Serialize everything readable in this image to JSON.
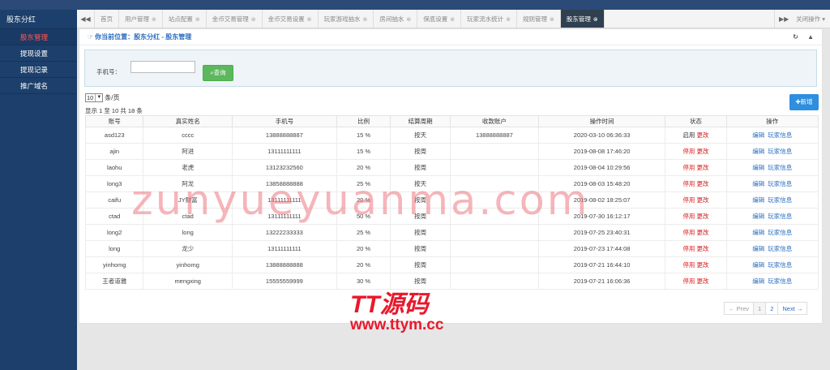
{
  "sidebar": {
    "title": "股东分红",
    "items": [
      {
        "label": "股东管理",
        "active": true
      },
      {
        "label": "提现设置",
        "active": false
      },
      {
        "label": "提现记录",
        "active": false
      },
      {
        "label": "推广域名",
        "active": false
      }
    ]
  },
  "tabbar": {
    "tabs": [
      "首页",
      "用户管理",
      "站点配置",
      "金币交易管理",
      "金币交易设置",
      "玩家游戏抽水",
      "房间抽水",
      "保底设置",
      "玩家流水统计",
      "规则管理",
      "股东管理"
    ],
    "active_index": 10,
    "close_ops_label": "关闭操作"
  },
  "breadcrumb": "你当前位置：股东分红 - 股东管理",
  "search": {
    "label": "手机号：",
    "value": "",
    "placeholder": "",
    "button_label": "查询"
  },
  "pagesize": {
    "value": "10",
    "suffix": "条/页"
  },
  "summary": "显示 1 至 10 共 18 条",
  "add_button": "新增",
  "table": {
    "headers": [
      "账号",
      "真实姓名",
      "手机号",
      "比例",
      "结算周期",
      "收款账户",
      "操作时间",
      "状态",
      "操作"
    ],
    "rows": [
      {
        "account": "asd123",
        "name": "cccc",
        "phone": "13888888887",
        "ratio": "15 %",
        "cycle": "按天",
        "payee": "13888888887",
        "time": "2020-03-10 06:36:33",
        "status": "启用",
        "status_on": true
      },
      {
        "account": "ajin",
        "name": "阿进",
        "phone": "13111111111",
        "ratio": "15 %",
        "cycle": "按周",
        "payee": "",
        "time": "2019-08-08 17:46:20",
        "status": "停用",
        "status_on": false
      },
      {
        "account": "laohu",
        "name": "老虎",
        "phone": "13123232560",
        "ratio": "20 %",
        "cycle": "按周",
        "payee": "",
        "time": "2019-08-04 10:29:56",
        "status": "停用",
        "status_on": false
      },
      {
        "account": "long3",
        "name": "阿龙",
        "phone": "13858888888",
        "ratio": "25 %",
        "cycle": "按天",
        "payee": "",
        "time": "2019-08-03 15:48:20",
        "status": "停用",
        "status_on": false
      },
      {
        "account": "caifu",
        "name": "JY财富",
        "phone": "13111111111",
        "ratio": "20 %",
        "cycle": "按周",
        "payee": "",
        "time": "2019-08-02 18:25:07",
        "status": "停用",
        "status_on": false
      },
      {
        "account": "ctad",
        "name": "ctad",
        "phone": "13111111111",
        "ratio": "50 %",
        "cycle": "按周",
        "payee": "",
        "time": "2019-07-30 16:12:17",
        "status": "停用",
        "status_on": false
      },
      {
        "account": "long2",
        "name": "long",
        "phone": "13222233333",
        "ratio": "25 %",
        "cycle": "按周",
        "payee": "",
        "time": "2019-07-25 23:40:31",
        "status": "停用",
        "status_on": false
      },
      {
        "account": "long",
        "name": "龙少",
        "phone": "13111111111",
        "ratio": "20 %",
        "cycle": "按周",
        "payee": "",
        "time": "2019-07-23 17:44:08",
        "status": "停用",
        "status_on": false
      },
      {
        "account": "yinhomg",
        "name": "yinhomg",
        "phone": "13888888888",
        "ratio": "20 %",
        "cycle": "按周",
        "payee": "",
        "time": "2019-07-21 16:44:10",
        "status": "停用",
        "status_on": false
      },
      {
        "account": "王者道雅",
        "name": "mengxing",
        "phone": "15555559999",
        "ratio": "30 %",
        "cycle": "按周",
        "payee": "",
        "time": "2019-07-21 16:06:36",
        "status": "停用",
        "status_on": false
      }
    ],
    "status_edit_label": "更改",
    "op_edit_label": "编辑",
    "op_player_label": "玩家信息"
  },
  "pager": {
    "prev": "← Prev",
    "pages": [
      "1",
      "2"
    ],
    "current": "1",
    "next": "Next →"
  },
  "watermark": {
    "text": "zunyueyuanma.com",
    "logo": "TT源码",
    "url": "www.ttym.cc"
  },
  "colors": {
    "sidebar": "#1c3f6b",
    "active_tab": "#2f4050",
    "accent_red": "#e02020",
    "link_blue": "#2a6dbf",
    "search_green": "#5cb85c",
    "add_blue": "#2e8ee0"
  }
}
